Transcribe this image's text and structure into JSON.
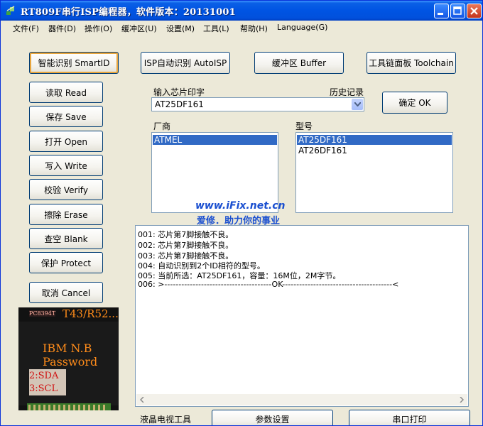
{
  "window": {
    "title": "RT809F串行ISP编程器，软件版本：20131001"
  },
  "menu": [
    {
      "label": "文件(F)"
    },
    {
      "label": "器件(D)"
    },
    {
      "label": "操作(O)"
    },
    {
      "label": "缓冲区(U)"
    },
    {
      "label": "设置(M)"
    },
    {
      "label": "工具(L)"
    },
    {
      "label": "帮助(H)"
    },
    {
      "label": "Language(G)"
    }
  ],
  "toolbar": {
    "smart_id": "智能识别 SmartID",
    "auto_isp": "ISP自动识别 AutoISP",
    "buffer": "缓冲区 Buffer",
    "toolchain": "工具链面板 Toolchain"
  },
  "side_buttons": [
    {
      "label": "读取 Read"
    },
    {
      "label": "保存 Save"
    },
    {
      "label": "打开 Open"
    },
    {
      "label": "写入 Write"
    },
    {
      "label": "校验 Verify"
    },
    {
      "label": "擦除 Erase"
    },
    {
      "label": "查空 Blank"
    },
    {
      "label": "保护 Protect"
    },
    {
      "label": "取消 Cancel"
    }
  ],
  "chip_input": {
    "label": "输入芯片印字",
    "history_label": "历史记录",
    "value": "AT25DF161",
    "ok_label": "确定 OK"
  },
  "vendor": {
    "label": "厂商",
    "items": [
      "ATMEL"
    ],
    "selected": 0
  },
  "model": {
    "label": "型号",
    "items": [
      "AT25DF161",
      "AT26DF161"
    ],
    "selected": 0
  },
  "watermark": {
    "url": "www.iFix.net.cn",
    "slogan": "爱修．助力你的事业"
  },
  "log": [
    "001: 芯片第7脚接触不良。",
    "002: 芯片第7脚接触不良。",
    "003: 芯片第7脚接触不良。",
    "004: 自动识别到2个ID相符的型号。",
    "005: 当前所选：AT25DF161，容量：16M位，2M字节。",
    "006: >--------------------------------------OK---------------------------------------<"
  ],
  "chip_image": {
    "label_top": "PC8394T",
    "model_text": "T43/R52...",
    "line1": "IBM  N.B",
    "line2": "Password",
    "pin1": "2:SDA",
    "pin2": "3:SCL"
  },
  "bottom": {
    "tv_tool": "液晶电视工具",
    "params": "参数设置",
    "serial_print": "串口打印"
  },
  "colors": {
    "title_bar": "#0054e3",
    "selection": "#316ac5",
    "watermark": "#1a4fd0",
    "chip_text": "#ff8c1a"
  }
}
